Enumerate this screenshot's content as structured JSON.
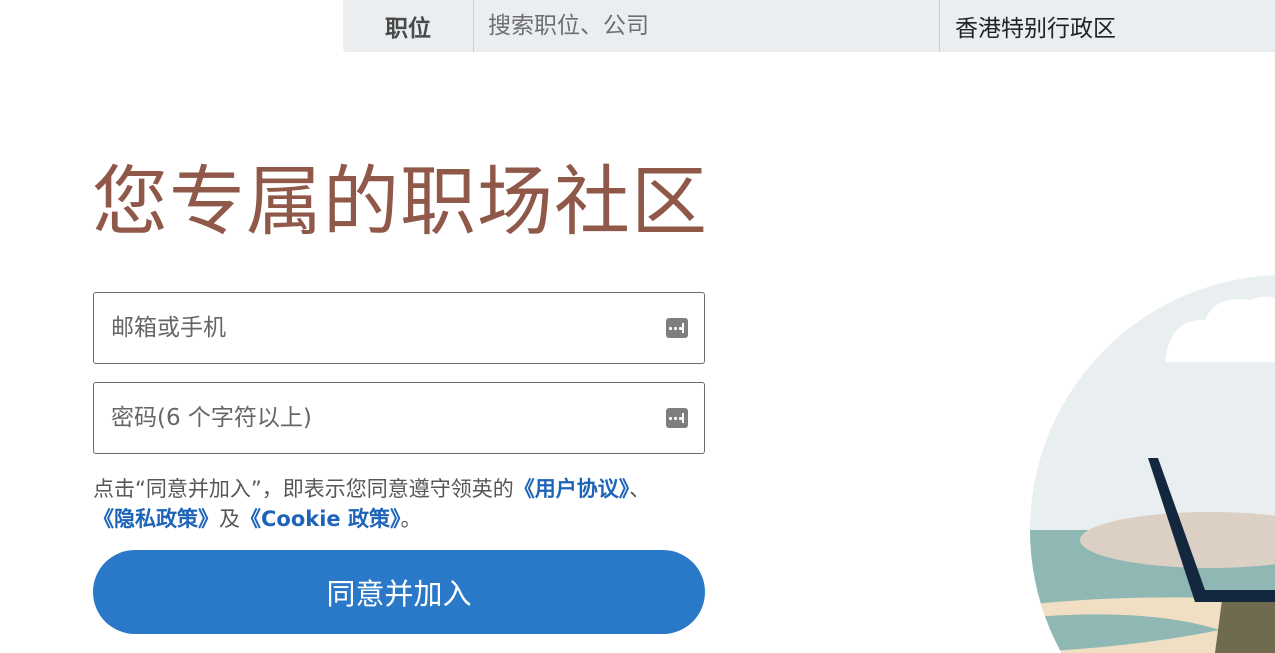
{
  "search": {
    "type_label": "职位",
    "query_placeholder": "搜索职位、公司",
    "location": "香港特别行政区"
  },
  "hero": {
    "headline": "您专属的职场社区"
  },
  "form": {
    "email_placeholder": "邮箱或手机",
    "password_placeholder": "密码(6 个字符以上)",
    "agreement": {
      "prefix": "点击“同意并加入”，即表示您同意遵守领英的",
      "user_agreement": "《用户协议》",
      "sep": "、",
      "privacy_policy": "《隐私政策》",
      "and": "及",
      "cookie_policy": "《Cookie 政策》",
      "suffix": "。"
    },
    "join_label": "同意并加入"
  },
  "colors": {
    "headline": "#8f5849",
    "accent": "#2a78c8",
    "link": "#1d64b8",
    "searchbar_bg": "#eaeef1"
  }
}
